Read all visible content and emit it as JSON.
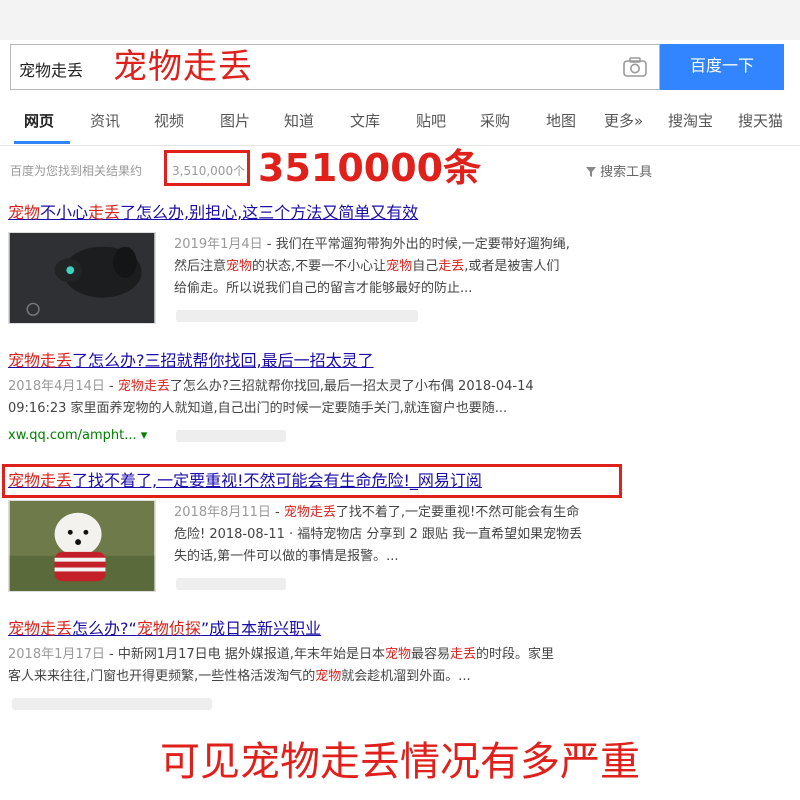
{
  "search": {
    "query": "宠物走丢",
    "annotation": "宠物走丢",
    "button_label": "百度一下",
    "camera_icon": "camera-icon"
  },
  "tabs": [
    {
      "label": "网页",
      "active": true
    },
    {
      "label": "资讯"
    },
    {
      "label": "视频"
    },
    {
      "label": "图片"
    },
    {
      "label": "知道"
    },
    {
      "label": "文库"
    },
    {
      "label": "贴吧"
    },
    {
      "label": "采购"
    },
    {
      "label": "地图"
    },
    {
      "label": "更多»"
    },
    {
      "label": "搜淘宝"
    },
    {
      "label": "搜天猫"
    }
  ],
  "stats": {
    "prefix": "百度为您找到相关结果约",
    "count": "3,510,000个",
    "annotation": "3510000条",
    "tools_label": "搜索工具"
  },
  "results": [
    {
      "title_parts": [
        "宠物",
        "不小心",
        "走丢",
        "了怎么办,别担心,这三个方法又简单又有效"
      ],
      "date": "2019年1月4日",
      "body_line1": " - 我们在平常遛狗带狗外出的时候,一定要带好遛狗绳,",
      "body_line2_a": "然后注意",
      "body_line2_hl1": "宠物",
      "body_line2_b": "的状态,不要一不小心让",
      "body_line2_hl2": "宠物",
      "body_line2_c": "自己",
      "body_line2_hl3": "走丢",
      "body_line2_d": ",或者是被害人们",
      "body_line3": "给偷走。所以说我们自己的留言才能够最好的防止..."
    },
    {
      "title_hl": "宠物走丢",
      "title_rest": "了怎么办?三招就帮你找回,最后一招太灵了",
      "date": "2018年4月14日",
      "body_line1_a": " - ",
      "body_line1_hl": "宠物走丢",
      "body_line1_b": "了怎么办?三招就帮你找回,最后一招太灵了小布偶 2018-04-14",
      "body_line2": "09:16:23 家里面养宠物的人就知道,自己出门的时候一定要随手关门,就连窗户也要随...",
      "source": "xw.qq.com/ampht... ▾"
    },
    {
      "title_hl": "宠物走丢",
      "title_rest": "了找不着了,一定要重视!不然可能会有生命危险!_网易订阅",
      "date": "2018年8月11日",
      "body_line1_a": " - ",
      "body_line1_hl": "宠物走丢",
      "body_line1_b": "了找不着了,一定要重视!不然可能会有生命",
      "body_line2": "危险! 2018-08-11 · 福特宠物店 分享到 2 跟贴 我一直希望如果宠物丢",
      "body_line3": "失的话,第一件可以做的事情是报警。..."
    },
    {
      "title_hl1": "宠物走丢",
      "title_mid": "怎么办?“",
      "title_hl2": "宠物侦探",
      "title_rest": "”成日本新兴职业",
      "date": "2018年1月17日",
      "body_line1_a": " - 中新网1月17日电 据外媒报道,年末年始是日本",
      "body_line1_hl1": "宠物",
      "body_line1_b": "最容易",
      "body_line1_hl2": "走丢",
      "body_line1_c": "的时段。家里",
      "body_line2_a": "客人来来往往,门窗也开得更频繁,一些性格活泼淘气的",
      "body_line2_hl": "宠物",
      "body_line2_b": "就会趁机溜到外面。..."
    }
  ],
  "caption": "可见宠物走丢情况有多严重",
  "colors": {
    "accent_red": "#e0201b",
    "link_blue": "#1a0dab",
    "button_blue": "#3385ff"
  }
}
